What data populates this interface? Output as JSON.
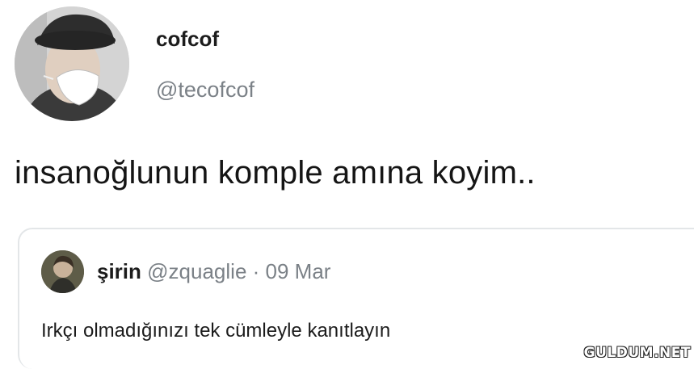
{
  "tweet": {
    "display_name": "cofcof",
    "handle": "@tecofcof",
    "text": "insanoğlunun komple amına koyim.."
  },
  "quoted_tweet": {
    "display_name": "şirin",
    "handle": "@zquaglie",
    "separator": " · ",
    "date": "09 Mar",
    "text": "Irkçı olmadığınızı tek cümleyle kanıtlayın"
  },
  "watermark": "GULDUM.NET",
  "colors": {
    "text": "#1c1c1c",
    "secondary": "#7b8187",
    "border": "#e3e6e8"
  }
}
